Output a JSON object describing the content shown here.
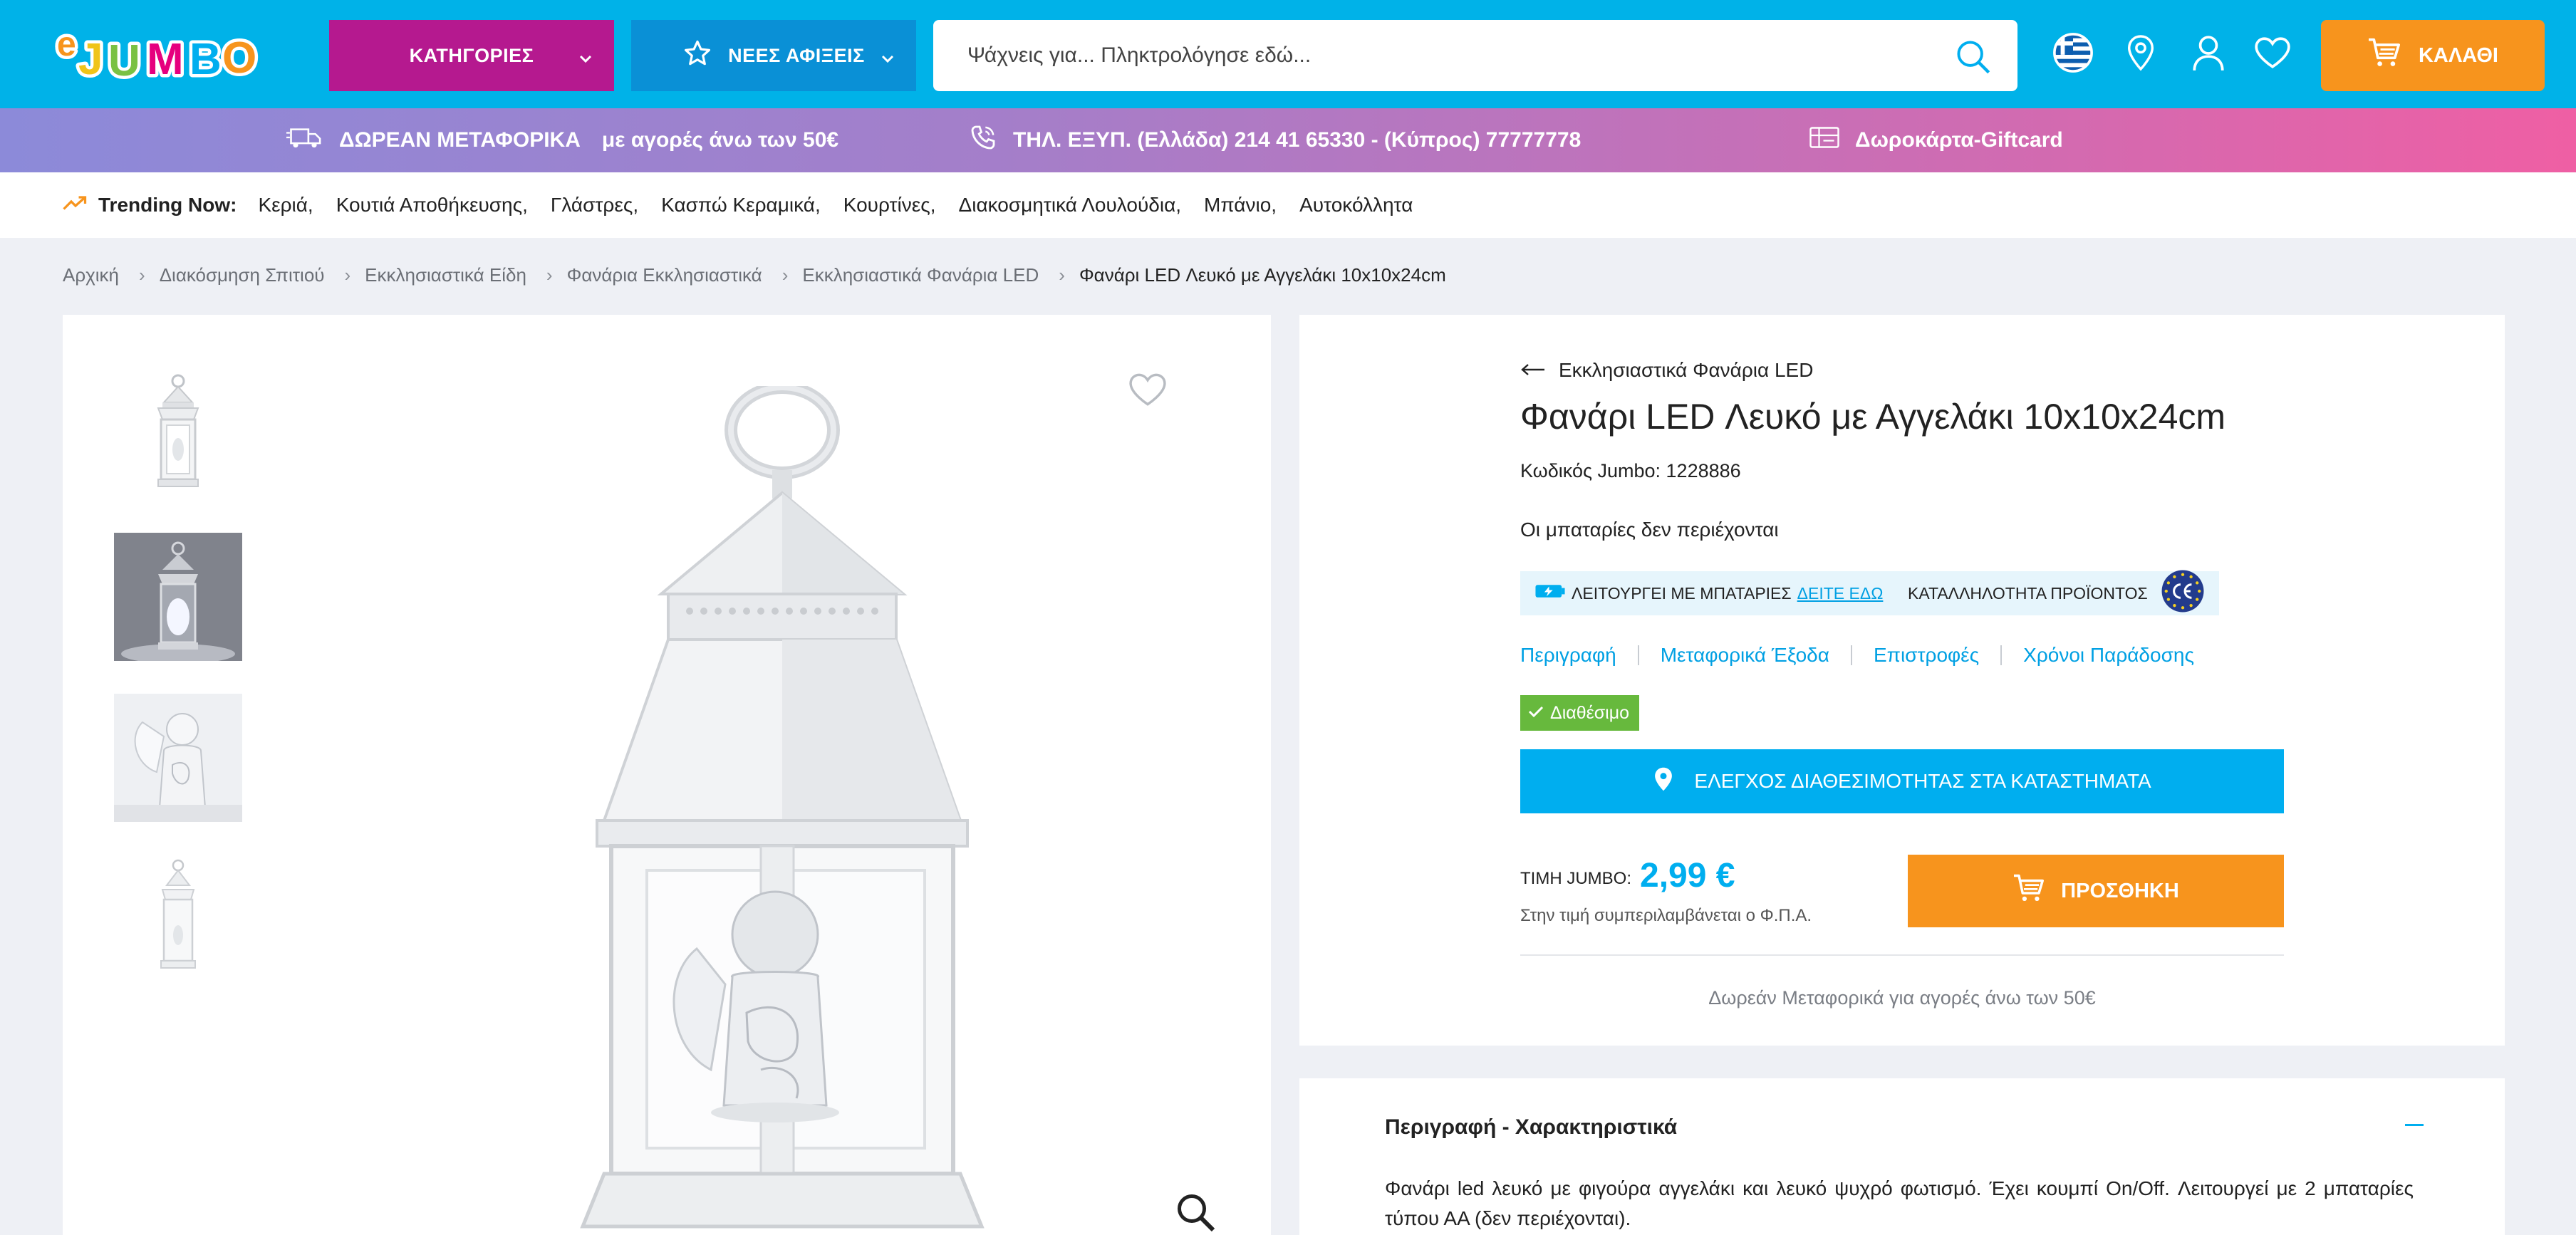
{
  "header": {
    "logo_text": "eJUMBO",
    "categories_label": "ΚΑΤΗΓΟΡΙΕΣ",
    "new_arrivals_label": "ΝΕΕΣ ΑΦΙΞΕΙΣ",
    "search_placeholder": "Ψάχνεις για... Πληκτρολόγησε εδώ...",
    "cart_label": "ΚΑΛΑΘΙ",
    "icons": [
      "greek-flag-icon",
      "location-pin-icon",
      "user-icon",
      "heart-icon",
      "cart-icon"
    ]
  },
  "promo": {
    "shipping_bold": "ΔΩΡΕΑΝ ΜΕΤΑΦΟΡΙΚΑ",
    "shipping_rest": "με αγορές άνω των 50€",
    "phone": "ΤΗΛ. ΕΞΥΠ.  (Ελλάδα) 214 41 65330 - (Κύπρος) 77777778",
    "giftcard": "Δωροκάρτα-Giftcard"
  },
  "trending": {
    "label": "Trending Now:",
    "items": [
      "Κεριά,",
      "Κουτιά Αποθήκευσης,",
      "Γλάστρες,",
      "Κασπώ Κεραμικά,",
      "Κουρτίνες,",
      "Διακοσμητικά Λουλούδια,",
      "Μπάνιο,",
      "Αυτοκόλλητα"
    ]
  },
  "breadcrumb": {
    "items": [
      "Αρχική",
      "Διακόσμηση Σπιτιού",
      "Εκκλησιαστικά Είδη",
      "Φανάρια Εκκλησιαστικά",
      "Εκκλησιαστικά Φανάρια LED"
    ],
    "current": "Φανάρι LED Λευκό με Αγγελάκι 10x10x24cm"
  },
  "product": {
    "back_label": "Εκκλησιαστικά Φανάρια LED",
    "title": "Φανάρι LED Λευκό με Αγγελάκι 10x10x24cm",
    "code": "Κωδικός Jumbo: 1228886",
    "battery_note": "Οι μπαταρίες δεν περιέχονται",
    "badge_battery": "ΛΕΙΤΟΥΡΓΕΙ ΜΕ ΜΠΑΤΑΡΙΕΣ",
    "badge_battery_link": "ΔΕΙΤΕ ΕΔΩ",
    "badge_ce": "ΚΑΤΑΛΛΗΛΟΤΗΤΑ ΠΡΟΪΟΝΤΟΣ",
    "tabs": [
      "Περιγραφή",
      "Μεταφορικά Έξοδα",
      "Επιστροφές",
      "Χρόνοι Παράδοσης"
    ],
    "availability": "Διαθέσιμο",
    "stock_check_label": "ΕΛΕΓΧΟΣ ΔΙΑΘΕΣΙΜΟΤΗΤΑΣ ΣΤΑ ΚΑΤΑΣΤΗΜΑΤΑ",
    "price_label": "ΤΙΜΗ JUMBO:",
    "price": "2,99 €",
    "vat_note": "Στην τιμή συμπεριλαμβάνεται ο Φ.Π.Α.",
    "add_label": "ΠΡΟΣΘΗΚΗ",
    "shipping_note": "Δωρεάν Μεταφορικά για αγορές άνω των 50€"
  },
  "description": {
    "title": "Περιγραφή - Χαρακτηριστικά",
    "text": "Φανάρι led λευκό με φιγούρα αγγελάκι και λευκό ψυχρό φωτισμό. Έχει κουμπί On/Off. Λειτουργεί με 2 μπαταρίες τύπου ΑΑ (δεν περιέχονται)."
  },
  "colors": {
    "header_bg": "#00b2e8",
    "categories_bg": "#b5198f",
    "new_arrivals_bg": "#0a90d6",
    "cart_bg": "#f7941d",
    "accent_blue": "#00aeef",
    "available_green": "#67b93d"
  }
}
